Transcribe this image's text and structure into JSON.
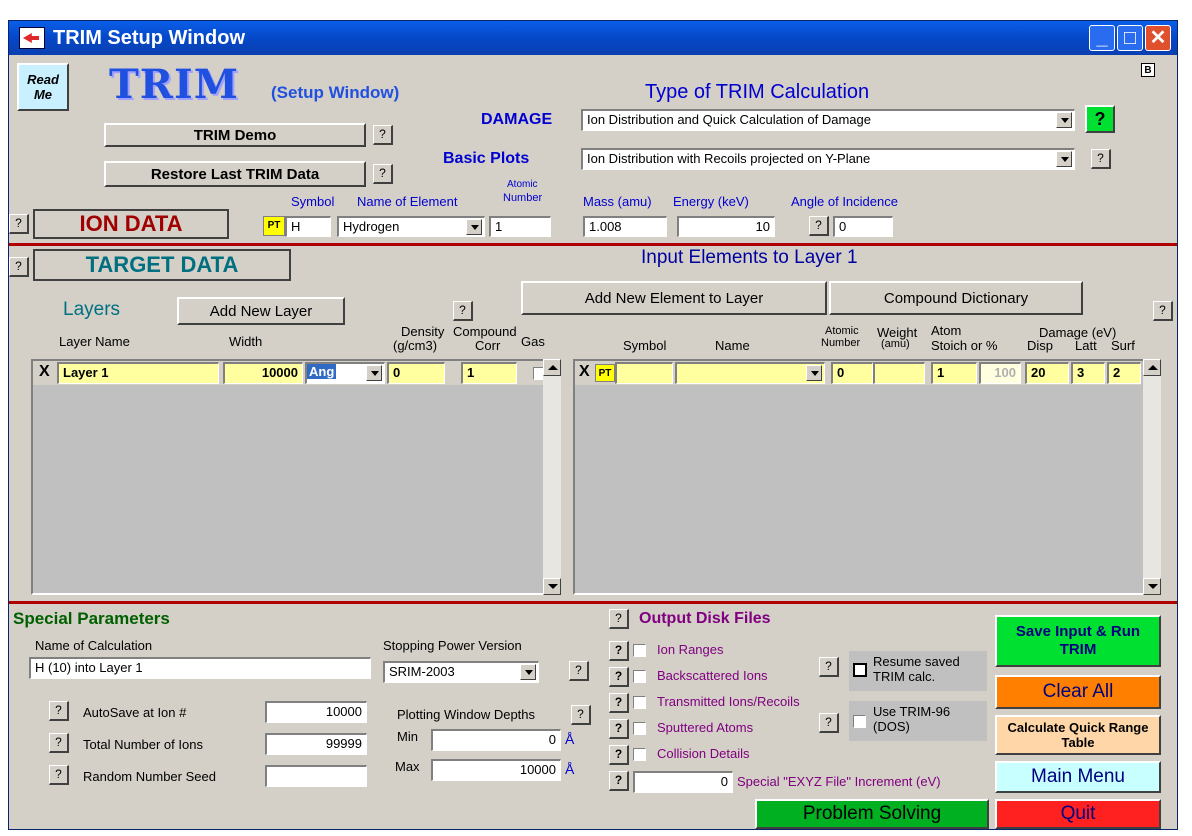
{
  "window": {
    "title": "TRIM Setup Window"
  },
  "header": {
    "read_me": "Read Me",
    "logo": "TRIM",
    "logo_sub": "(Setup Window)",
    "demo_button": "TRIM Demo",
    "restore_button": "Restore Last TRIM Data",
    "b_badge": "B"
  },
  "calc_type": {
    "heading": "Type of TRIM Calculation",
    "damage_label": "DAMAGE",
    "damage_value": "Ion Distribution and Quick Calculation of Damage",
    "plots_label": "Basic Plots",
    "plots_value": "Ion Distribution with Recoils projected on Y-Plane"
  },
  "ion": {
    "heading": "ION DATA",
    "col_symbol": "Symbol",
    "col_name": "Name of Element",
    "col_atomic": "Atomic",
    "col_atomic2": "Number",
    "col_mass": "Mass (amu)",
    "col_energy": "Energy (keV)",
    "col_angle": "Angle of Incidence",
    "pt": "PT",
    "symbol": "H",
    "name": "Hydrogen",
    "atomic_number": "1",
    "mass": "1.008",
    "energy": "10",
    "angle": "0"
  },
  "target": {
    "heading": "TARGET DATA",
    "layers_label": "Layers",
    "add_layer": "Add New Layer",
    "col_layer_name": "Layer Name",
    "col_width": "Width",
    "col_density": "Density",
    "col_density2": "(g/cm3)",
    "col_compound": "Compound",
    "col_corr": "Corr",
    "col_gas": "Gas",
    "layer": {
      "x": "X",
      "name": "Layer 1",
      "width": "10000",
      "unit": "Ang",
      "density": "0",
      "corr": "1"
    }
  },
  "elements": {
    "heading": "Input Elements to Layer 1",
    "add_element": "Add New Element to Layer",
    "compound_dict": "Compound Dictionary",
    "col_symbol": "Symbol",
    "col_name": "Name",
    "col_atomic": "Atomic",
    "col_atomic2": "Number",
    "col_weight": "Weight",
    "col_weight2": "(amu)",
    "col_atom": "Atom",
    "col_stoich": "Stoich or %",
    "col_damage": "Damage (eV)",
    "col_disp": "Disp",
    "col_latt": "Latt",
    "col_surf": "Surf",
    "row": {
      "x": "X",
      "pt": "PT",
      "atomic": "0",
      "stoich": "1",
      "percent": "100",
      "disp": "20",
      "latt": "3",
      "surf": "2"
    }
  },
  "special": {
    "heading": "Special Parameters",
    "calc_name_label": "Name of Calculation",
    "calc_name": "H (10) into Layer 1",
    "stopping_label": "Stopping Power Version",
    "stopping_value": "SRIM-2003",
    "autosave_label": "AutoSave at Ion #",
    "autosave": "10000",
    "total_label": "Total Number of Ions",
    "total": "99999",
    "seed_label": "Random Number Seed",
    "seed": "",
    "plot_depths_label": "Plotting Window Depths",
    "min_label": "Min",
    "min": "0",
    "max_label": "Max",
    "max": "10000",
    "unit": "Å"
  },
  "output": {
    "heading": "Output Disk Files",
    "files": [
      "Ion Ranges",
      "Backscattered Ions",
      "Transmitted Ions/Recoils",
      "Sputtered Atoms",
      "Collision Details"
    ],
    "exyz_value": "0",
    "exyz_label": "Special \"EXYZ File\" Increment (eV)",
    "resume": "Resume saved TRIM calc.",
    "use96": "Use TRIM-96 (DOS)"
  },
  "actions": {
    "save_run": "Save Input & Run TRIM",
    "clear_all": "Clear All",
    "quick_range": "Calculate Quick Range Table",
    "main_menu": "Main Menu",
    "problem_solving": "Problem Solving",
    "quit": "Quit"
  },
  "colors": {
    "title_blue": "#0548c8",
    "save_green": "#00e030",
    "clear_orange": "#ff7f00",
    "quick_peach": "#ffd6a8",
    "menu_cyan": "#c8ffff",
    "quit_red": "#ff2020",
    "label_blue": "#0000d0",
    "output_purple": "#800080"
  }
}
